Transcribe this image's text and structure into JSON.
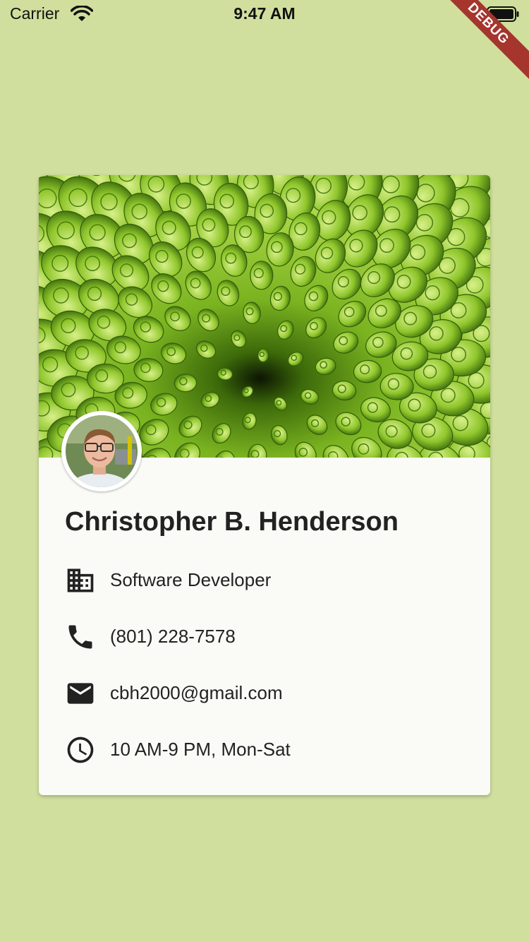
{
  "status_bar": {
    "carrier": "Carrier",
    "time": "9:47 AM",
    "icons": [
      "wifi-icon",
      "battery-icon"
    ]
  },
  "debug_banner": "DEBUG",
  "colors": {
    "background": "#d0df9d",
    "card": "#fafaf6",
    "banner": "#a5352d",
    "text": "#222222"
  },
  "profile": {
    "name": "Christopher B. Henderson",
    "header_image": "green-succulent-flower-photo",
    "avatar": "profile-photo"
  },
  "details": [
    {
      "icon": "business-icon",
      "text": "Software Developer"
    },
    {
      "icon": "phone-icon",
      "text": "(801) 228-7578"
    },
    {
      "icon": "email-icon",
      "text": "cbh2000@gmail.com"
    },
    {
      "icon": "clock-icon",
      "text": "10 AM-9 PM, Mon-Sat"
    }
  ]
}
